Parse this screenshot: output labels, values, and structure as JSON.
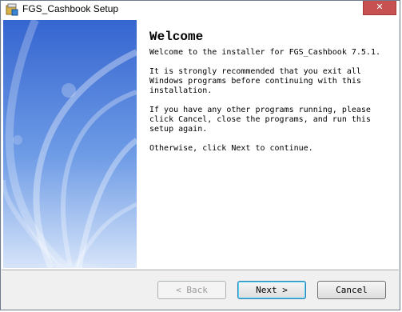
{
  "window": {
    "title": "FGS_Cashbook Setup",
    "close_glyph": "✕"
  },
  "welcome": {
    "heading": "Welcome",
    "paragraphs": [
      "Welcome to the installer for FGS_Cashbook 7.5.1.",
      "It is strongly recommended that you exit all\nWindows programs before continuing with this\ninstallation.",
      "If you have any other programs running, please\nclick Cancel, close the programs, and run this\nsetup again.",
      "Otherwise, click Next to continue."
    ]
  },
  "buttons": {
    "back": "< Back",
    "next": "Next >",
    "cancel": "Cancel"
  },
  "colors": {
    "close": "#c75050",
    "banner_top": "#3f6fd6",
    "banner_bottom": "#cfe0f8"
  }
}
